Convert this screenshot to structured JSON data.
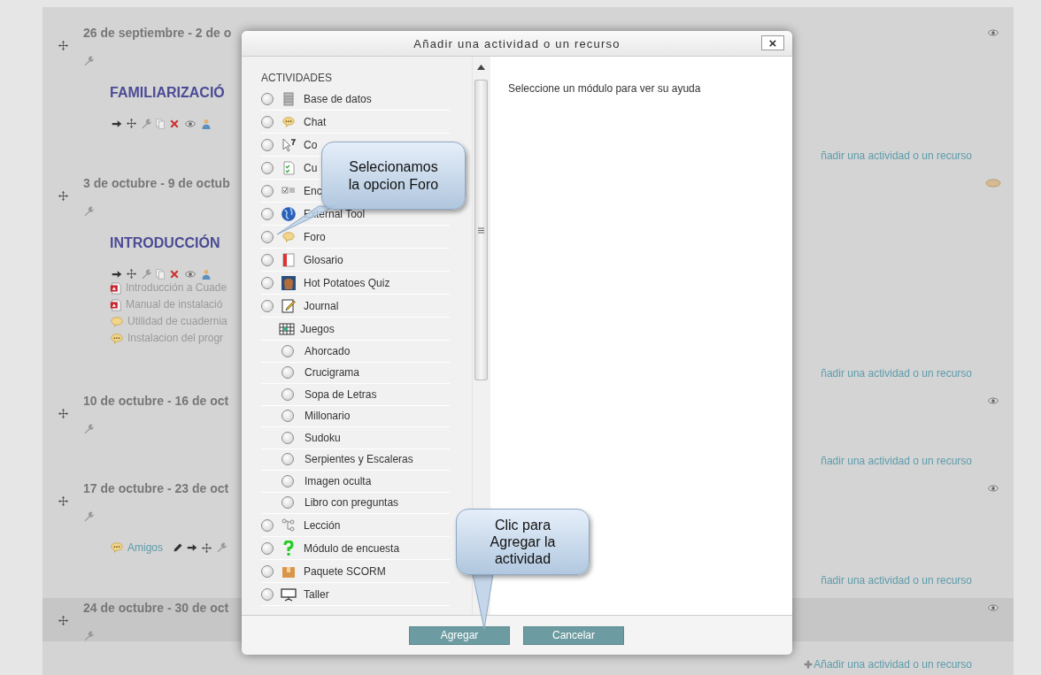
{
  "sections": [
    {
      "title": "26 de septiembre - 2 de o",
      "current": false,
      "hovered": false,
      "content": [
        {
          "kind": "heading",
          "text": "FAMILIARIZACIÓ"
        },
        {
          "kind": "tools"
        }
      ],
      "add_link": {
        "text": "ñadir una actividad o un recurso",
        "icon": false
      }
    },
    {
      "title": "3 de octubre - 9 de octub",
      "current": true,
      "hovered": false,
      "content": [
        {
          "kind": "heading",
          "text": "INTRODUCCIÓN"
        },
        {
          "kind": "tools"
        },
        {
          "kind": "pdf",
          "text": "Introducción a Cuade"
        },
        {
          "kind": "pdf",
          "text": "Manual de instalació"
        },
        {
          "kind": "forum",
          "text": "Utilidad de cuadernia"
        },
        {
          "kind": "chat",
          "text": "Instalacion del progr"
        }
      ],
      "add_link": {
        "text": "ñadir una actividad o un recurso",
        "icon": false
      }
    },
    {
      "title": "10 de octubre - 16 de oct",
      "current": false,
      "hovered": false,
      "add_link": {
        "text": "ñadir una actividad o un recurso",
        "icon": false
      }
    },
    {
      "title": "17 de octubre - 23 de oct",
      "current": false,
      "hovered": false,
      "content": [
        {
          "kind": "chat_link",
          "text": "Amigos"
        }
      ],
      "add_link": {
        "text": "ñadir una actividad o un recurso",
        "icon": false
      }
    },
    {
      "title": "24 de octubre - 30 de oct",
      "current": false,
      "hovered": true,
      "add_link": {
        "text": "Añadir una actividad o un recurso",
        "icon": true
      }
    }
  ],
  "dialog": {
    "title": "Añadir una actividad o un recurso",
    "close": "×",
    "section_label": "ACTIVIDADES",
    "modules": [
      {
        "kind": "radio",
        "label": "Base de datos",
        "selected": false
      },
      {
        "kind": "radio",
        "label": "Chat",
        "selected": false
      },
      {
        "kind": "radio",
        "label": "Co",
        "selected": false
      },
      {
        "kind": "radio",
        "label": "Cu",
        "selected": false
      },
      {
        "kind": "radio",
        "label": "Enc",
        "selected": false
      },
      {
        "kind": "radio",
        "label": "External Tool",
        "selected": false
      },
      {
        "kind": "radio",
        "label": "Foro",
        "selected": false
      },
      {
        "kind": "radio",
        "label": "Glosario",
        "selected": false
      },
      {
        "kind": "radio",
        "label": "Hot Potatoes Quiz",
        "selected": false
      },
      {
        "kind": "radio",
        "label": "Journal",
        "selected": false
      },
      {
        "kind": "group",
        "label": "Juegos"
      },
      {
        "kind": "sub",
        "label": "Ahorcado",
        "selected": false
      },
      {
        "kind": "sub",
        "label": "Crucigrama",
        "selected": false
      },
      {
        "kind": "sub",
        "label": "Sopa de Letras",
        "selected": false
      },
      {
        "kind": "sub",
        "label": "Millonario",
        "selected": false
      },
      {
        "kind": "sub",
        "label": "Sudoku",
        "selected": false
      },
      {
        "kind": "sub",
        "label": "Serpientes y Escaleras",
        "selected": false
      },
      {
        "kind": "sub",
        "label": "Imagen oculta",
        "selected": false
      },
      {
        "kind": "sub",
        "label": "Libro con preguntas",
        "selected": false
      },
      {
        "kind": "radio",
        "label": "Lección",
        "selected": false
      },
      {
        "kind": "radio",
        "label": "Módulo de encuesta",
        "selected": false
      },
      {
        "kind": "radio",
        "label": "Paquete SCORM",
        "selected": false
      },
      {
        "kind": "radio",
        "label": "Taller",
        "selected": false
      }
    ],
    "help": "Seleccione un módulo para ver su ayuda",
    "buttons": [
      "Agregar",
      "Cancelar"
    ]
  },
  "callouts": [
    "Selecionamos\nla opcion Foro",
    "Clic para\nAgregar la\nactividad"
  ]
}
